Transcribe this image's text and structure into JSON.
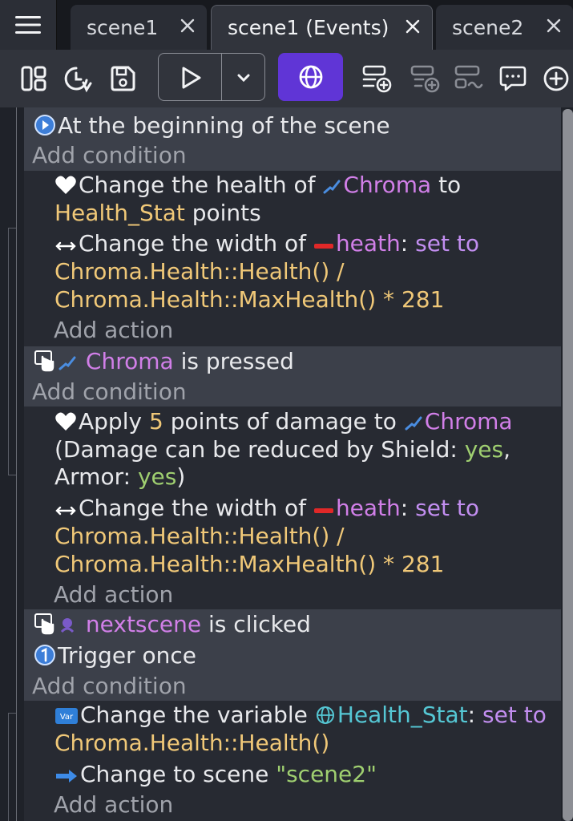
{
  "tabs": [
    {
      "label": "scene1",
      "active": false
    },
    {
      "label": "scene1 (Events)",
      "active": true
    },
    {
      "label": "scene2",
      "active": false
    }
  ],
  "toolbar": {
    "icons": [
      "project-manager-icon",
      "history-icon",
      "save-icon",
      "preview-play-icon",
      "preview-options-chevron-icon",
      "network-preview-icon",
      "add-event-icon",
      "add-subevent-icon",
      "add-other-icon",
      "add-comment-icon",
      "add-more-icon"
    ],
    "network_color": "#6035d6"
  },
  "events": {
    "e1": {
      "condition": "At the beginning of the scene",
      "add_condition": "Add condition",
      "a1": {
        "pre": "Change the health of",
        "obj": "Chroma",
        "to": "to",
        "var": "Health_Stat",
        "post": "points"
      },
      "a2": {
        "pre": "Change the width of",
        "obj": "heath",
        "colon": ":",
        "set": "set to",
        "expr1": "Chroma.Health::Health() /",
        "expr2": "Chroma.Health::MaxHealth() * 281"
      },
      "add_action": "Add action"
    },
    "e2": {
      "obj": "Chroma",
      "cond_rest": "is pressed",
      "add_condition": "Add condition",
      "a1": {
        "pre": "Apply",
        "num": "5",
        "mid": "points of damage to",
        "obj": "Chroma",
        "line2a": "(Damage can be reduced by Shield:",
        "yes1": "yes",
        "comma": ",",
        "line3a": "Armor:",
        "yes2": "yes",
        "line3b": ")"
      },
      "a2": {
        "pre": "Change the width of",
        "obj": "heath",
        "colon": ":",
        "set": "set to",
        "expr1": "Chroma.Health::Health() /",
        "expr2": "Chroma.Health::MaxHealth() * 281"
      },
      "add_action": "Add action"
    },
    "e3": {
      "obj": "nextscene",
      "cond_rest": "is clicked",
      "trigger": "Trigger once",
      "add_condition": "Add condition",
      "a1": {
        "pre": "Change the variable",
        "var": "Health_Stat",
        "colon": ":",
        "set": "set to",
        "expr": "Chroma.Health::Health()"
      },
      "a2": {
        "pre": "Change to scene",
        "str": "\"scene2\""
      },
      "add_action": "Add action"
    }
  },
  "colors": {
    "object": "#d17fe8",
    "expression": "#f0c878",
    "boolean": "#9fcf70",
    "variable": "#55c7d4",
    "accent": "#6035d6"
  }
}
